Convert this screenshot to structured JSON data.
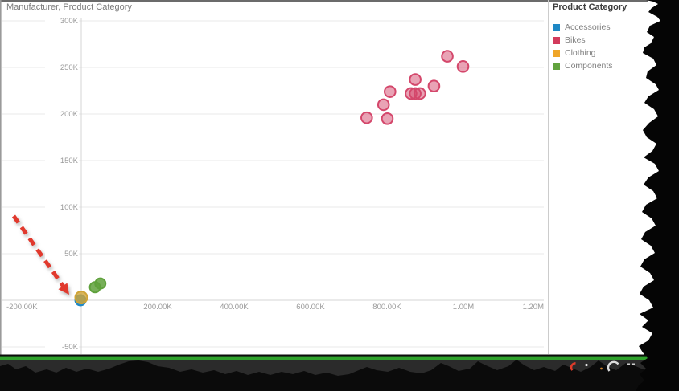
{
  "title": {
    "text": "Manufacturer, Product Category"
  },
  "legend": {
    "title": "Product Category",
    "items": [
      {
        "label": "Accessories",
        "color": "#1E88C5"
      },
      {
        "label": "Bikes",
        "color": "#D23A5C"
      },
      {
        "label": "Clothing",
        "color": "#EFA528"
      },
      {
        "label": "Components",
        "color": "#62A33E"
      }
    ]
  },
  "chart_data": {
    "type": "scatter",
    "title": "Manufacturer, Product Category",
    "legend_title": "Product Category",
    "legend_position": "right",
    "grid": "horizontal",
    "x_axis": {
      "ticks": [
        {
          "label": "-200.00K",
          "value_k": -200
        },
        {
          "label": "200.00K",
          "value_k": 200
        },
        {
          "label": "400.00K",
          "value_k": 400
        },
        {
          "label": "600.00K",
          "value_k": 600
        },
        {
          "label": "800.00K",
          "value_k": 800
        },
        {
          "label": "1.00M",
          "value_k": 1000
        },
        {
          "label": "1.20M",
          "value_k": 1200
        }
      ],
      "range_k": [
        -200,
        1215
      ]
    },
    "y_axis": {
      "ticks": [
        {
          "label": "300K",
          "value_k": 300
        },
        {
          "label": "250K",
          "value_k": 250
        },
        {
          "label": "200K",
          "value_k": 200
        },
        {
          "label": "150K",
          "value_k": 150
        },
        {
          "label": "100K",
          "value_k": 100
        },
        {
          "label": "50K",
          "value_k": 50
        },
        {
          "label": "-50K",
          "value_k": -50
        }
      ],
      "range_k": [
        -58,
        305
      ]
    },
    "series": [
      {
        "name": "Accessories",
        "color": "#1E88C5",
        "fill_opacity": 0.9,
        "radius_px": 6.5,
        "points_k": [
          [
            -2,
            0
          ]
        ]
      },
      {
        "name": "Bikes",
        "color": "#D4476B",
        "fill_opacity": 0.5,
        "radius_px": 6.8,
        "points_k": [
          [
            747,
            196
          ],
          [
            791,
            210
          ],
          [
            801,
            195
          ],
          [
            808,
            224
          ],
          [
            863,
            222
          ],
          [
            874,
            222
          ],
          [
            886,
            222
          ],
          [
            874,
            237
          ],
          [
            923,
            230
          ],
          [
            958,
            262
          ],
          [
            999,
            251
          ]
        ]
      },
      {
        "name": "Clothing",
        "color": "#CFA436",
        "fill_opacity": 0.8,
        "radius_px": 7.5,
        "points_k": [
          [
            0,
            3
          ]
        ]
      },
      {
        "name": "Components",
        "color": "#5FA13C",
        "fill_opacity": 0.85,
        "radius_px": 6.5,
        "points_k": [
          [
            36,
            14
          ],
          [
            50,
            18
          ]
        ]
      }
    ],
    "annotations": [
      {
        "type": "dashed-arrow",
        "color": "#E1392D",
        "points_to": "origin data point"
      }
    ]
  },
  "decorations": {
    "torn_edges": [
      "right",
      "bottom"
    ],
    "taskbar_line_color": "#2FA12C"
  }
}
